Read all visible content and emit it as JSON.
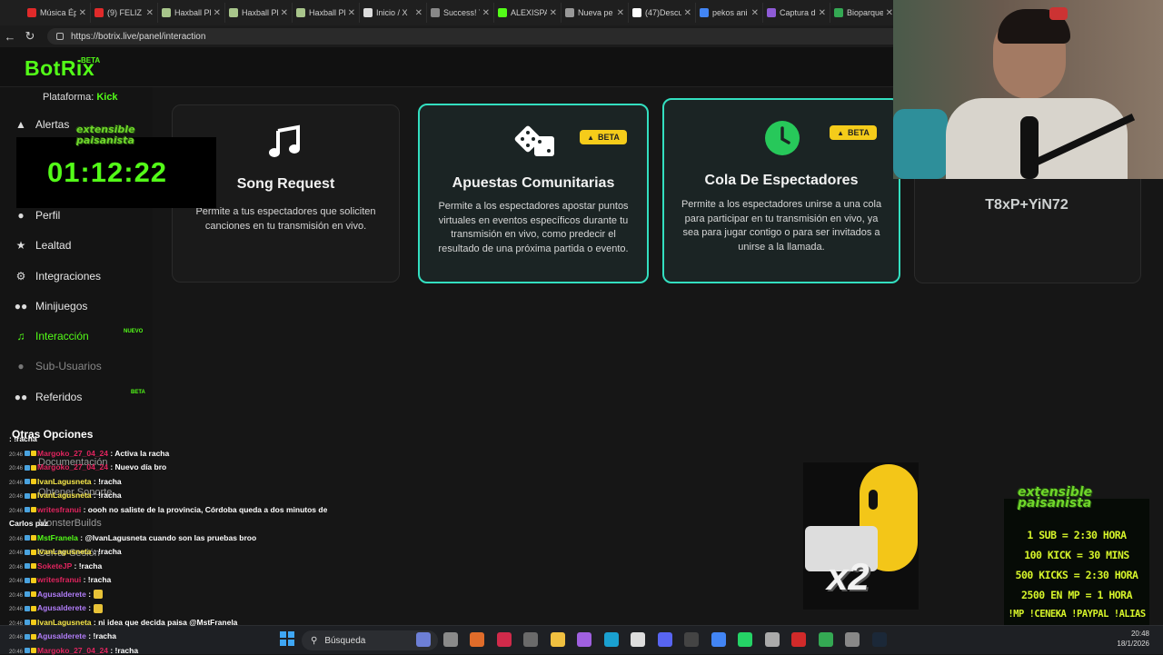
{
  "browser": {
    "tabs": [
      {
        "title": "Música Ép",
        "color": "#e02a2a"
      },
      {
        "title": "(9) FELIZ C",
        "color": "#e02a2a"
      },
      {
        "title": "Haxball Pl",
        "color": "#a8c58b"
      },
      {
        "title": "Haxball Pl",
        "color": "#a8c58b"
      },
      {
        "title": "Haxball Pl",
        "color": "#a8c58b"
      },
      {
        "title": "Inicio / X",
        "color": "#dddddd"
      },
      {
        "title": "Success! Y",
        "color": "#888888"
      },
      {
        "title": "ALEXISPAI",
        "color": "#53fc18"
      },
      {
        "title": "Nueva pe",
        "color": "#999999"
      },
      {
        "title": "(47)Descu",
        "color": "#ffffff"
      },
      {
        "title": "pekos ani",
        "color": "#4285f4"
      },
      {
        "title": "Captura d",
        "color": "#8e5bd6"
      },
      {
        "title": "Bioparque",
        "color": "#34a853"
      }
    ],
    "url": "https://botrix.live/panel/interaction"
  },
  "header": {
    "logo": "BotRix",
    "logo_badge": "BETA",
    "platform_label": "Plataforma:",
    "platform_value": "Kick"
  },
  "sidebar": {
    "items": [
      {
        "label": "Alertas",
        "icon": "warning-icon"
      },
      {
        "label": "Perfil",
        "icon": "user-icon"
      },
      {
        "label": "Lealtad",
        "icon": "trophy-icon"
      },
      {
        "label": "Integraciones",
        "icon": "gear-icon"
      },
      {
        "label": "Minijuegos",
        "icon": "gamepad-icon"
      },
      {
        "label": "Interacción",
        "icon": "music-icon",
        "badge": "NUEVO"
      },
      {
        "label": "Sub-Usuarios",
        "icon": "users-icon"
      },
      {
        "label": "Referidos",
        "icon": "user-group-icon",
        "badge": "BETA"
      }
    ],
    "other_options": "Otras Opciones",
    "other_items": [
      "Documentación",
      "Obtener Soporte",
      "MonsterBuilds",
      "Cerrar Sesión"
    ]
  },
  "cards": [
    {
      "title": "Song Request",
      "desc": "Permite a tus espectadores que soliciten canciones en tu transmisión en vivo.",
      "icon": "music-note-icon"
    },
    {
      "title": "Apuestas Comunitarias",
      "desc": "Permite a los espectadores apostar puntos virtuales en eventos específicos durante tu transmisión en vivo, como predecir el resultado de una próxima partida o evento.",
      "icon": "dice-icon",
      "badge": "BETA"
    },
    {
      "title": "Cola De Espectadores",
      "desc": "Permite a los espectadores unirse a una cola para participar en tu transmisión en vivo, ya sea para jugar contigo o para ser invitados a unirse a la llamada.",
      "icon": "clock-icon",
      "badge": "BETA"
    }
  ],
  "kick_card": {
    "text": "T8xP+YiN72"
  },
  "overlay": {
    "timer": "01:12:22",
    "brand": "extensible paisanista",
    "multiplier": "x2",
    "promo": [
      "1 SUB = 2:30 HORA",
      "100 KICK = 30 MINS",
      "500 KICKS = 2:30 HORA",
      "2500 EN MP = 1 HORA",
      "!MP !CENEKA !PAYPAL !ALIAS"
    ]
  },
  "chat": [
    {
      "user": "",
      "color": "#ffffff",
      "msg": ": !racha"
    },
    {
      "user": "Margoko_27_04_24",
      "color": "#e0245e",
      "msg": ": Activa la racha"
    },
    {
      "user": "Margoko_27_04_24",
      "color": "#e0245e",
      "msg": ": Nuevo día bro"
    },
    {
      "user": "IvanLagusneta",
      "color": "#f7e84a",
      "msg": ": !racha"
    },
    {
      "user": "IvanLagusneta",
      "color": "#f7e84a",
      "msg": ": !racha"
    },
    {
      "user": "writesfranui",
      "color": "#e0245e",
      "msg": ": oooh no saliste de la provincia, Córdoba queda a dos minutos de"
    },
    {
      "user": "",
      "color": "#ffffff",
      "msg": "Carlos paz"
    },
    {
      "user": "MstFranela",
      "color": "#53fc18",
      "msg": ": @IvanLagusneta cuando son las pruebas broo"
    },
    {
      "user": "IvanLagusneta",
      "color": "#f7e84a",
      "msg": ": !racha"
    },
    {
      "user": "SoketeJP",
      "color": "#e0245e",
      "msg": ": !racha"
    },
    {
      "user": "writesfranui",
      "color": "#e0245e",
      "msg": ": !racha"
    },
    {
      "user": "Agusalderete",
      "color": "#b07cf7",
      "msg": ":"
    },
    {
      "user": "Agusalderete",
      "color": "#b07cf7",
      "msg": ":"
    },
    {
      "user": "IvanLagusneta",
      "color": "#f7e84a",
      "msg": ": ni idea que decida paisa @MstFranela"
    },
    {
      "user": "Agusalderete",
      "color": "#b07cf7",
      "msg": ": !racha"
    },
    {
      "user": "Margoko_27_04_24",
      "color": "#e0245e",
      "msg": ": !racha"
    }
  ],
  "chat_time": "20:46",
  "taskbar": {
    "search_placeholder": "Búsqueda",
    "time": "20:48",
    "date": "18/1/2026"
  }
}
